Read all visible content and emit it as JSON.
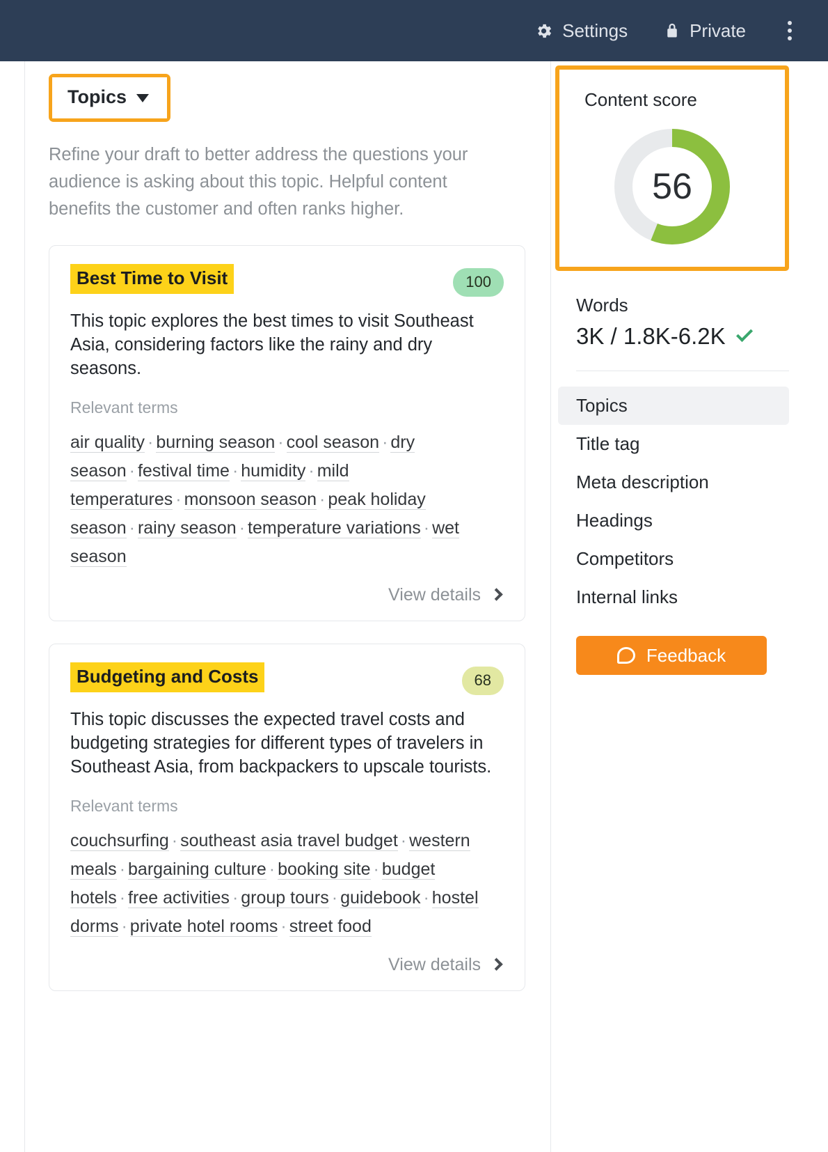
{
  "topbar": {
    "settings_label": "Settings",
    "privacy_label": "Private",
    "settings_icon": "gear-icon",
    "privacy_icon": "lock-icon",
    "overflow_icon": "kebab-menu-icon"
  },
  "main": {
    "dropdown_label": "Topics",
    "intro": "Refine your draft to better address the questions your audience is asking about this topic. Helpful content benefits the customer and often ranks higher.",
    "relevant_terms_label": "Relevant terms",
    "view_details_label": "View details",
    "cards": [
      {
        "title": "Best Time to Visit",
        "score": "100",
        "score_tone": "green",
        "description": "This topic explores the best times to visit Southeast Asia, considering factors like the rainy and dry seasons.",
        "terms": [
          "air quality",
          "burning season",
          "cool season",
          "dry season",
          "festival time",
          "humidity",
          "mild temperatures",
          "monsoon season",
          "peak holiday season",
          "rainy season",
          "temperature variations",
          "wet season"
        ]
      },
      {
        "title": "Budgeting and Costs",
        "score": "68",
        "score_tone": "olive",
        "description": "This topic discusses the expected travel costs and budgeting strategies for different types of travelers in Southeast Asia, from backpackers to upscale tourists.",
        "terms": [
          "couchsurfing",
          "southeast asia travel budget",
          "western meals",
          "bargaining culture",
          "booking site",
          "budget hotels",
          "free activities",
          "group tours",
          "guidebook",
          "hostel dorms",
          "private hotel rooms",
          "street food"
        ]
      }
    ]
  },
  "sidebar": {
    "score_title": "Content score",
    "score_value": "56",
    "score_percent": 56,
    "score_color": "#8cbf3f",
    "score_track_color": "#e8eaec",
    "words_label": "Words",
    "words_value": "3K / 1.8K-6.2K",
    "words_status_icon": "check-icon",
    "nav_items": [
      {
        "label": "Topics",
        "active": true
      },
      {
        "label": "Title tag",
        "active": false
      },
      {
        "label": "Meta description",
        "active": false
      },
      {
        "label": "Headings",
        "active": false
      },
      {
        "label": "Competitors",
        "active": false
      },
      {
        "label": "Internal links",
        "active": false
      }
    ],
    "feedback_label": "Feedback",
    "feedback_icon": "speech-bubble-icon",
    "feedback_color": "#f7891b"
  },
  "highlight_color": "#f7a41c"
}
